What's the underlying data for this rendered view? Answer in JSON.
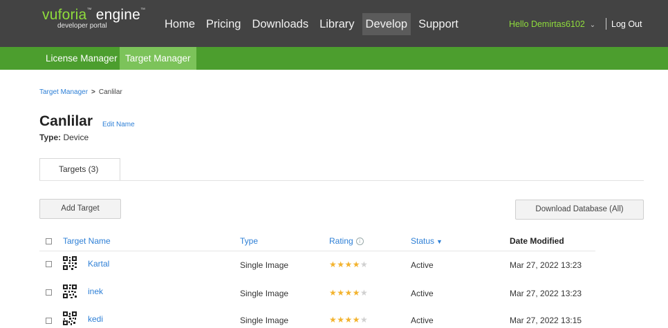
{
  "logo": {
    "brand_main": "vuforia",
    "brand_engine": "engine",
    "tm": "™",
    "subtitle": "developer portal"
  },
  "nav": {
    "items": [
      "Home",
      "Pricing",
      "Downloads",
      "Library",
      "Develop",
      "Support"
    ],
    "active": "Develop"
  },
  "user": {
    "greeting": "Hello Demirtas6102",
    "logout": "Log Out"
  },
  "subnav": {
    "license_manager": "License Manager",
    "target_manager": "Target Manager"
  },
  "breadcrumb": {
    "root": "Target Manager",
    "current": "Canlilar"
  },
  "database": {
    "name": "Canlilar",
    "edit_label": "Edit Name",
    "type_label": "Type:",
    "type_value": "Device"
  },
  "tabs": {
    "targets": "Targets (3)"
  },
  "actions": {
    "add_target": "Add Target",
    "download_database": "Download Database (All)"
  },
  "table": {
    "columns": {
      "name": "Target Name",
      "type": "Type",
      "rating": "Rating",
      "status": "Status",
      "date": "Date Modified"
    },
    "rows": [
      {
        "name": "Kartal",
        "type": "Single Image",
        "rating": 4,
        "status": "Active",
        "date": "Mar 27, 2022 13:23"
      },
      {
        "name": "inek",
        "type": "Single Image",
        "rating": 4,
        "status": "Active",
        "date": "Mar 27, 2022 13:23"
      },
      {
        "name": "kedi",
        "type": "Single Image",
        "rating": 4,
        "status": "Active",
        "date": "Mar 27, 2022 13:15"
      }
    ]
  },
  "colors": {
    "topbar": "#434343",
    "subbar": "#4c9e2e",
    "active_subtab": "#7cc35a",
    "accent_green": "#8fdc3c",
    "link_blue": "#2d7fd6",
    "star": "#f3b32e"
  },
  "icons": {
    "info": "info-circle-icon",
    "status_sort": "chevron-down-icon",
    "user_menu": "chevron-down-icon",
    "target_thumb": "qr-code-icon"
  }
}
